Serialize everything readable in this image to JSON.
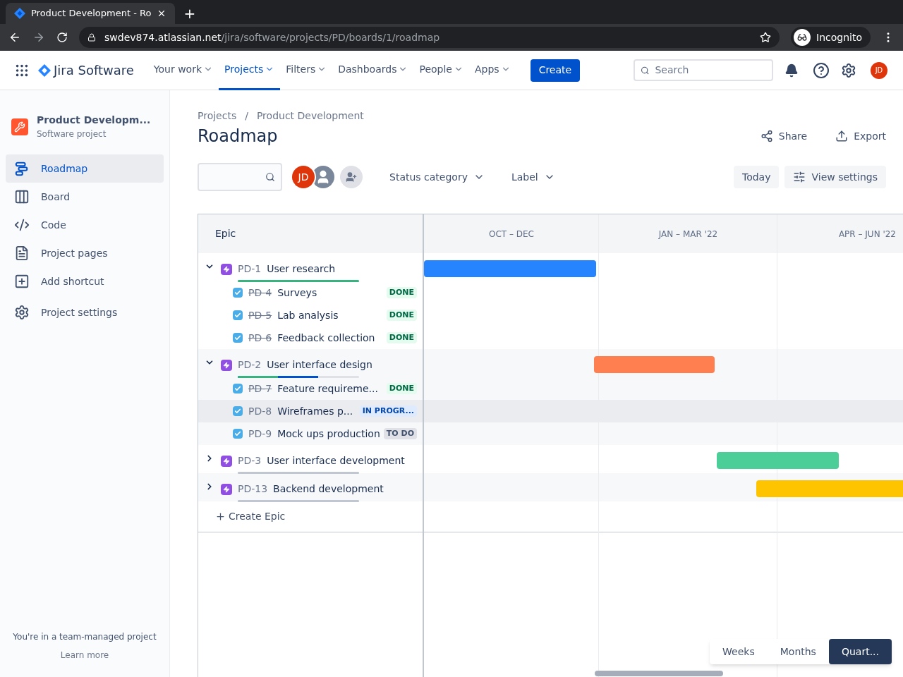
{
  "browser": {
    "tab_title": "Product Development - Ro",
    "new_tab": "+",
    "url_host": "swdev874.atlassian.net",
    "url_path": "/jira/software/projects/PD/boards/1/roadmap",
    "profile": "Incognito"
  },
  "nav": {
    "product": "Jira Software",
    "items": [
      {
        "label": "Your work",
        "selected": false
      },
      {
        "label": "Projects",
        "selected": true
      },
      {
        "label": "Filters",
        "selected": false
      },
      {
        "label": "Dashboards",
        "selected": false
      },
      {
        "label": "People",
        "selected": false
      },
      {
        "label": "Apps",
        "selected": false
      }
    ],
    "create": "Create",
    "search_placeholder": "Search",
    "avatar": "JD"
  },
  "sidebar": {
    "project_name": "Product Developm...",
    "project_type": "Software project",
    "items": [
      {
        "label": "Roadmap",
        "selected": true
      },
      {
        "label": "Board",
        "selected": false
      },
      {
        "label": "Code",
        "selected": false
      },
      {
        "label": "Project pages",
        "selected": false
      },
      {
        "label": "Add shortcut",
        "selected": false
      },
      {
        "label": "Project settings",
        "selected": false
      }
    ],
    "footer_text": "You're in a team-managed project",
    "footer_link": "Learn more"
  },
  "breadcrumbs": [
    "Projects",
    "Product Development"
  ],
  "breadcrumb_separator": "/",
  "title": "Roadmap",
  "actions": [
    "Share",
    "Export"
  ],
  "toolbar": {
    "avatars": [
      {
        "kind": "initials",
        "text": "JD"
      },
      {
        "kind": "silhouette"
      },
      {
        "kind": "add"
      }
    ],
    "filters": [
      "Status category",
      "Label"
    ],
    "today": "Today",
    "view_settings": "View settings"
  },
  "roadmap": {
    "column_header": "Epic",
    "periods": [
      "OCT – DEC",
      "JAN – MAR '22",
      "APR – JUN '22"
    ],
    "epics": [
      {
        "key": "PD-1",
        "title": "User research",
        "expanded": true,
        "color": "#2684ff",
        "progress": [
          {
            "kind": "done",
            "level": 1
          }
        ],
        "children": [
          {
            "key": "PD-4",
            "title": "Surveys",
            "checked": true,
            "hovered": false,
            "status": {
              "label": "DONE",
              "kind": "done"
            }
          },
          {
            "key": "PD-5",
            "title": "Lab analysis",
            "checked": true,
            "hovered": false,
            "status": {
              "label": "DONE",
              "kind": "done"
            }
          },
          {
            "key": "PD-6",
            "title": "Feedback collection",
            "checked": true,
            "hovered": false,
            "status": {
              "label": "DONE",
              "kind": "done"
            }
          }
        ]
      },
      {
        "key": "PD-2",
        "title": "User interface design",
        "expanded": true,
        "color": "#ff7f50",
        "progress": [
          {
            "kind": "done",
            "level": 0.33
          },
          {
            "kind": "in_progress",
            "level": 0.66
          }
        ],
        "children": [
          {
            "key": "PD-7",
            "title": "Feature requireme...",
            "checked": true,
            "hovered": false,
            "status": {
              "label": "DONE",
              "kind": "done"
            }
          },
          {
            "key": "PD-8",
            "title": "Wireframes p...",
            "checked": true,
            "hovered": true,
            "status": {
              "label": "IN PROGR...",
              "kind": "in_progress"
            }
          },
          {
            "key": "PD-9",
            "title": "Mock ups production",
            "checked": true,
            "hovered": false,
            "status": {
              "label": "TO DO",
              "kind": "todo"
            }
          }
        ]
      },
      {
        "key": "PD-3",
        "title": "User interface development",
        "expanded": false,
        "color": "#4bce97",
        "progress": [
          {
            "kind": "todo",
            "level": 1
          }
        ]
      },
      {
        "key": "PD-13",
        "title": "Backend development",
        "expanded": false,
        "color": "#ffc400",
        "progress": [
          {
            "kind": "todo",
            "level": 1
          }
        ]
      }
    ],
    "create_epic": "Create Epic"
  },
  "zoom": [
    {
      "label": "Weeks",
      "selected": false
    },
    {
      "label": "Months",
      "selected": false
    },
    {
      "label": "Quart...",
      "selected": true
    }
  ]
}
